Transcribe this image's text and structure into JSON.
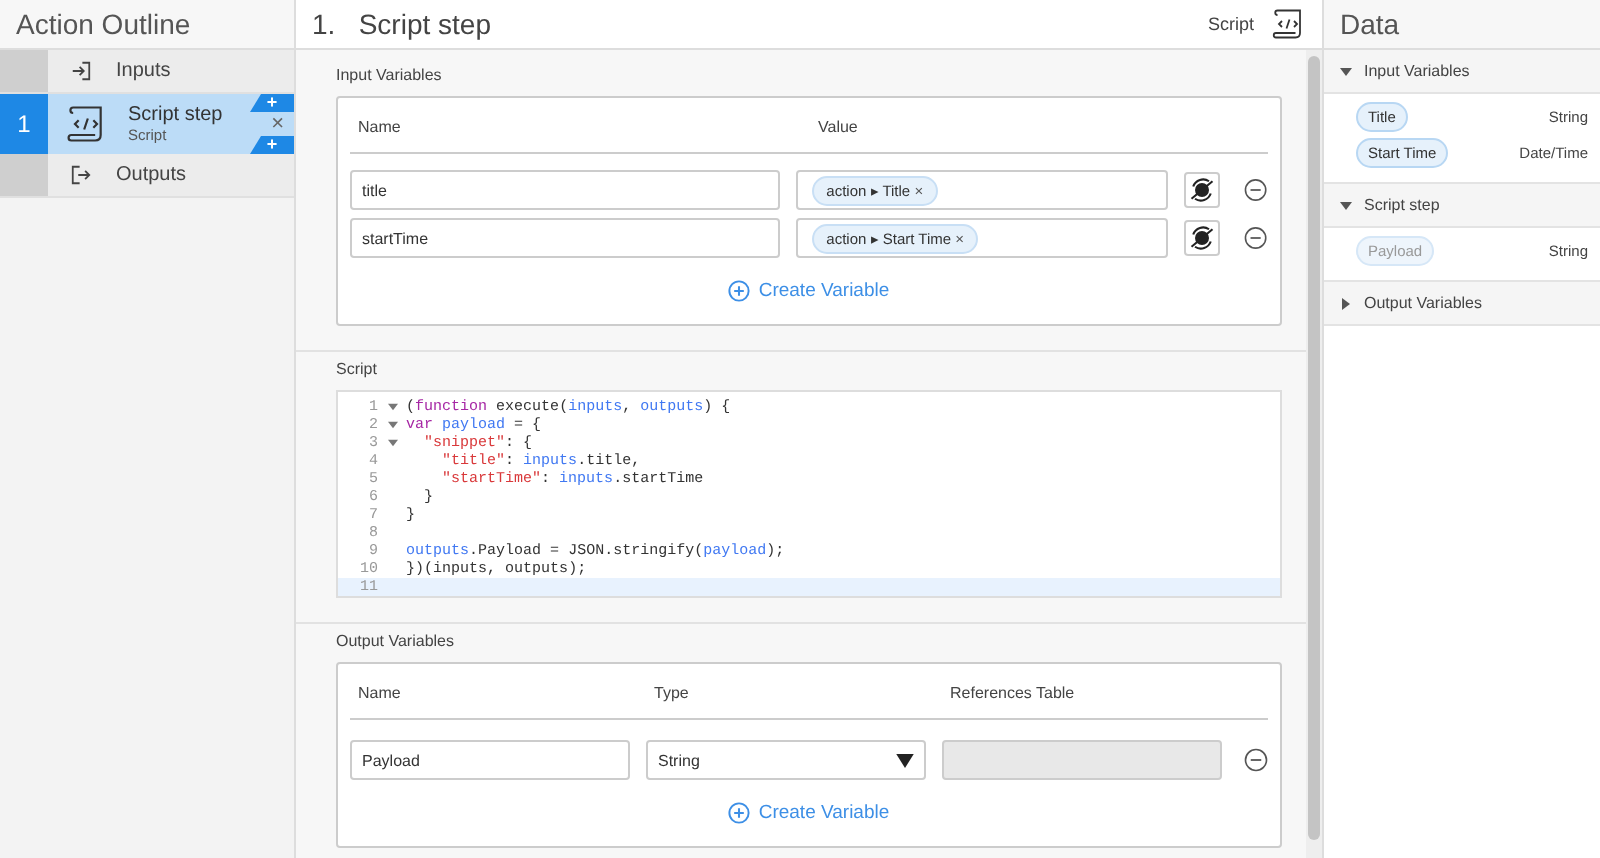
{
  "outline": {
    "title": "Action Outline",
    "items": [
      {
        "kind": "inputs",
        "label": "Inputs",
        "selected": false
      },
      {
        "kind": "step",
        "number": "1",
        "label": "Script step",
        "subtitle": "Script",
        "remove": "×",
        "add_above": "+",
        "add_below": "+",
        "selected": true
      },
      {
        "kind": "outputs",
        "label": "Outputs",
        "selected": false
      }
    ]
  },
  "step": {
    "number": "1.",
    "title": "Script step",
    "type": "Script",
    "input_variables": {
      "label": "Input Variables",
      "columns": [
        "Name",
        "Value"
      ],
      "rows": [
        {
          "name": "title",
          "pill": "action ▸ Title",
          "pill_remove": "×"
        },
        {
          "name": "startTime",
          "pill": "action ▸ Start Time",
          "pill_remove": "×"
        }
      ],
      "create": "Create Variable"
    },
    "script": {
      "label": "Script",
      "lines": [
        {
          "no": "1",
          "fold": true,
          "active": false,
          "text": "(function execute(inputs, outputs) {"
        },
        {
          "no": "2",
          "fold": true,
          "active": false,
          "text": "var payload = {"
        },
        {
          "no": "3",
          "fold": true,
          "active": false,
          "text": "  \"snippet\": {"
        },
        {
          "no": "4",
          "fold": false,
          "active": false,
          "text": "    \"title\": inputs.title,"
        },
        {
          "no": "5",
          "fold": false,
          "active": false,
          "text": "    \"startTime\": inputs.startTime"
        },
        {
          "no": "6",
          "fold": false,
          "active": false,
          "text": "  }"
        },
        {
          "no": "7",
          "fold": false,
          "active": false,
          "text": "}"
        },
        {
          "no": "8",
          "fold": false,
          "active": false
        },
        {
          "no": "9",
          "fold": false,
          "active": false,
          "text": "outputs.Payload = JSON.stringify(payload);"
        },
        {
          "no": "10",
          "fold": false,
          "active": false,
          "text": "})(inputs, outputs);"
        },
        {
          "no": "11",
          "fold": false,
          "active": true
        }
      ]
    },
    "output_variables": {
      "label": "Output Variables",
      "columns": [
        "Name",
        "Type",
        "References Table"
      ],
      "rows": [
        {
          "name": "Payload",
          "type": "String",
          "disabled": true
        }
      ],
      "create": "Create Variable"
    }
  },
  "data": {
    "title": "Data",
    "sections": [
      {
        "label": "Input Variables",
        "expanded": true,
        "items": [
          {
            "pill": "Title",
            "type": "String",
            "muted": false
          },
          {
            "pill": "Start Time",
            "type": "Date/Time",
            "muted": false
          }
        ]
      },
      {
        "label": "Script step",
        "expanded": true,
        "items": [
          {
            "pill": "Payload",
            "type": "String",
            "muted": true
          }
        ]
      },
      {
        "label": "Output Variables",
        "expanded": false
      }
    ]
  }
}
